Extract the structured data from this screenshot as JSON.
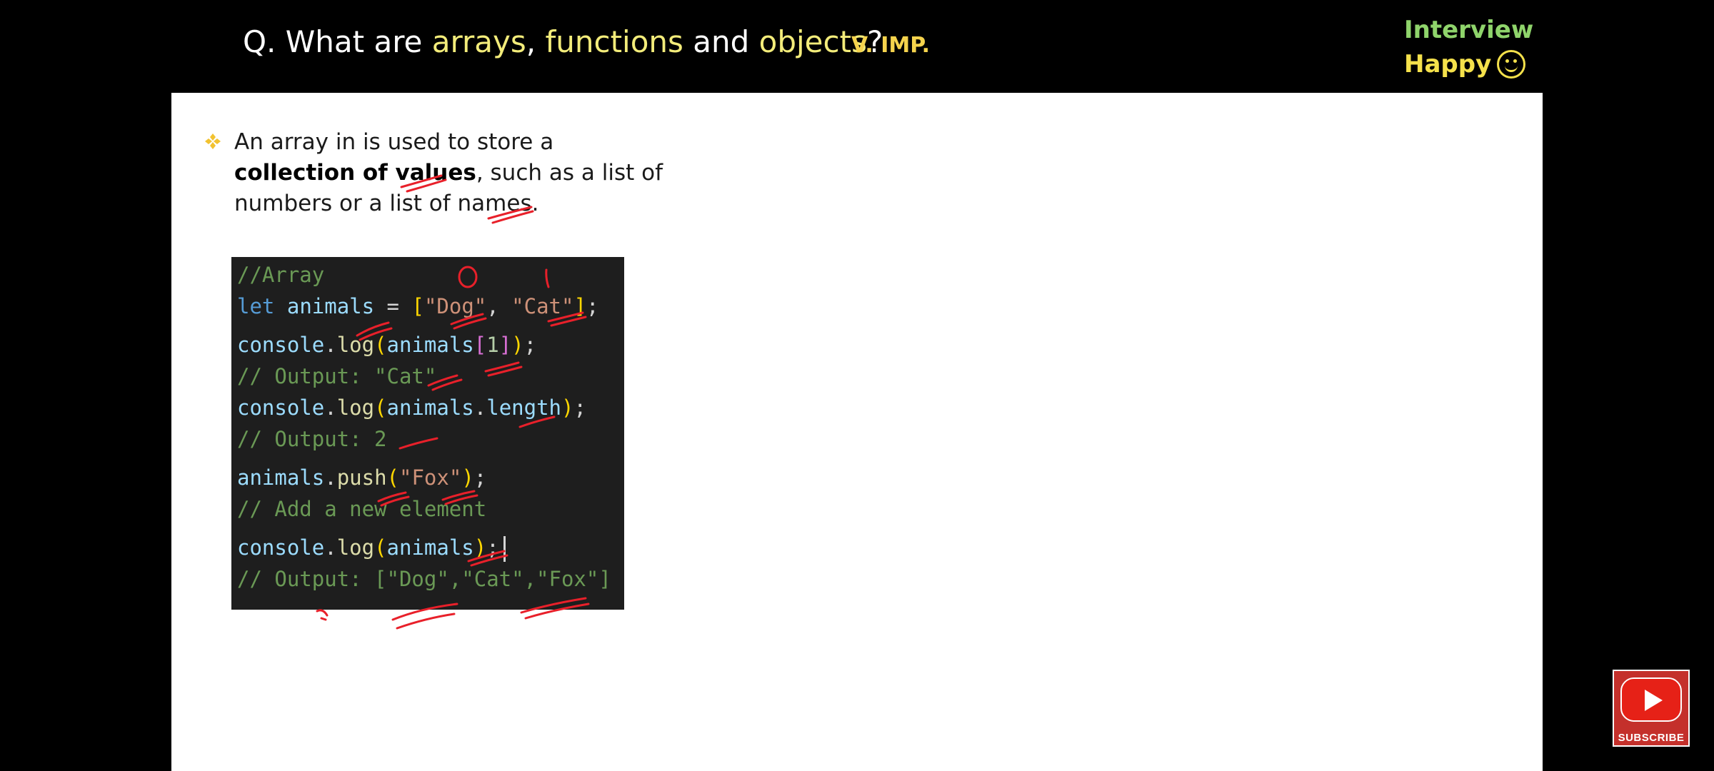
{
  "header": {
    "title_prefix": "Q. What are ",
    "term1": "arrays",
    "sep1": ", ",
    "term2": "functions",
    "sep2": " and ",
    "term3": "objects",
    "suffix": "?",
    "badge": "V. IMP."
  },
  "brand": {
    "line1": "Interview",
    "line2": "Happy"
  },
  "bullet": {
    "text_a": "An array in is used to store a",
    "bold": "collection of values",
    "text_b": ", such as a list of",
    "text_c": "numbers or a list of names."
  },
  "code": {
    "l1": "//Array",
    "l2_kw": "let",
    "l2_var": "animals",
    "l2_eq": " = ",
    "l2_s1": "\"Dog\"",
    "l2_comma": ", ",
    "l2_s2": "\"Cat\"",
    "l2_end": ";",
    "l3_obj": "console",
    "l3_fn": "log",
    "l3_var": "animals",
    "l3_idx": "1",
    "l4": "// Output: \"Cat\"",
    "l5_obj": "console",
    "l5_fn": "log",
    "l5_var": "animals",
    "l5_prop": "length",
    "l6": "// Output: 2",
    "l7_var": "animals",
    "l7_fn": "push",
    "l7_str": "\"Fox\"",
    "l8": "// Add a new element",
    "l9_obj": "console",
    "l9_fn": "log",
    "l9_var": "animals",
    "l10": "// Output: [\"Dog\",\"Cat\",\"Fox\"]"
  },
  "subscribe": {
    "label": "SUBSCRIBE"
  },
  "colors": {
    "highlight_terms": "#f3ec7a",
    "badge": "#f5d34d",
    "brand_green": "#8fd46b",
    "brand_yellow": "#f5e14b",
    "annotation_red": "#e8202a",
    "code_bg": "#1e1e1e"
  },
  "icons": {
    "bullet": "diamond-bullet-icon",
    "smile": "smiley-face-icon",
    "subscribe": "youtube-play-icon"
  }
}
